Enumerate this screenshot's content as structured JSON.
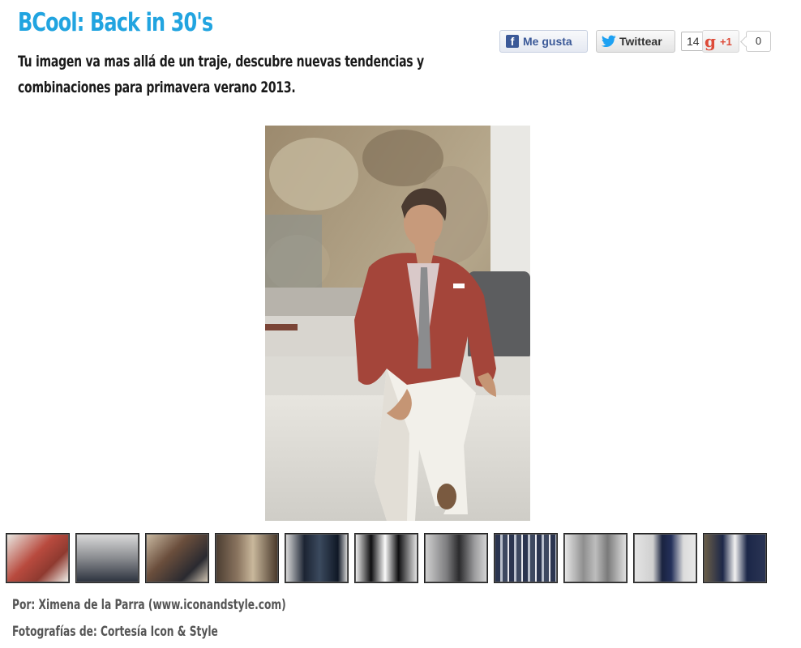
{
  "article": {
    "title": "BCool: Back in 30's",
    "subtitle": "Tu imagen va mas allá de un traje, descubre nuevas tendencias y combinaciones para primavera verano 2013."
  },
  "social": {
    "facebook": {
      "icon": "facebook-icon",
      "label": "Me gusta"
    },
    "twitter": {
      "icon": "twitter-bird-icon",
      "label": "Twittear",
      "count": "14"
    },
    "google_plus": {
      "icon": "google-plus-icon",
      "label": "+1",
      "g_glyph": "g",
      "count": "0"
    }
  },
  "colors": {
    "title": "#21a4e0",
    "facebook": "#3b5998",
    "twitter": "#1da1f2",
    "google_plus": "#dd4b39"
  },
  "gallery": {
    "main_photo": "man-red-blazer-photo",
    "thumbnails": [
      "thumb-red-blazer",
      "thumb-grey-suit-street",
      "thumb-seated-couple",
      "thumb-brown-jacket",
      "thumb-plaid-blazer",
      "thumb-black-suit-tie",
      "thumb-grey-cardigan",
      "thumb-plaid-shirt",
      "thumb-grey-suit",
      "thumb-navy-trousers",
      "thumb-navy-blazer"
    ]
  },
  "credits": {
    "author": "Por: Ximena de la Parra (www.iconandstyle.com)",
    "photos": "Fotografías de: Cortesía Icon & Style"
  }
}
